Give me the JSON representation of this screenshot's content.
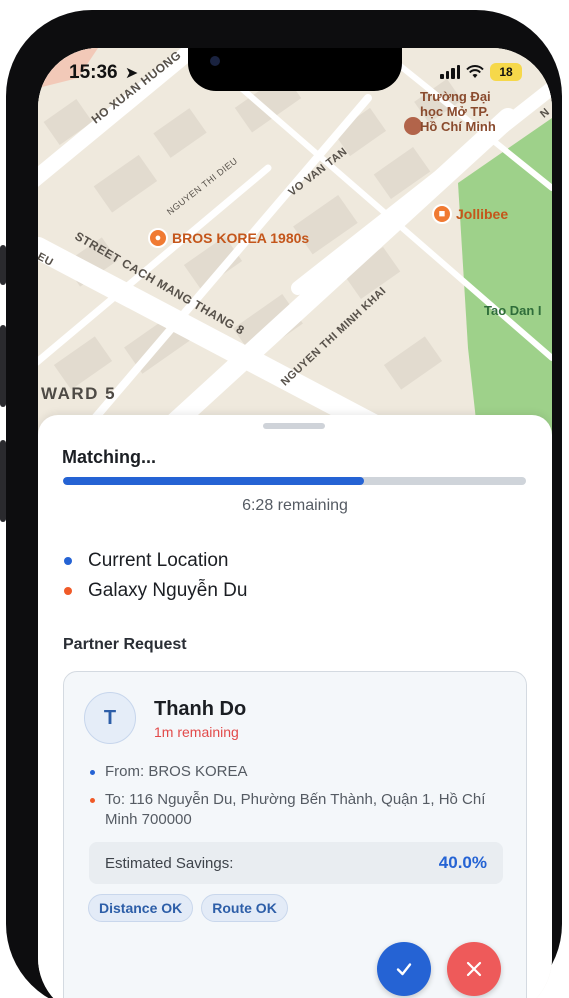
{
  "status_bar": {
    "time": "15:36",
    "battery": "18",
    "icons": [
      "location-arrow-icon",
      "signal-icon",
      "wifi-icon",
      "battery-icon"
    ]
  },
  "map": {
    "district_label": "WARD 5",
    "streets": [
      {
        "name": "HO XUAN HUONG"
      },
      {
        "name": "NGUYEN THI DIEU"
      },
      {
        "name": "VO VAN TAN"
      },
      {
        "name": "STREET CACH MANG THANG 8"
      },
      {
        "name": "NGUYEN THI MINH KHAI"
      },
      {
        "name": "EU"
      },
      {
        "name": "N"
      }
    ],
    "pois": {
      "university": "Trường Đại học Mở TP. Hồ Chí Minh",
      "university_lines": [
        "Trường Đại",
        "học Mở TP.",
        "Hồ Chí Minh"
      ],
      "jollibee": "Jollibee",
      "bros_korea": "BROS KOREA 1980s",
      "park": "Tao Dan I"
    },
    "colors": {
      "park": "#9ed18a",
      "poi": "#f07a32",
      "university_icon": "#b2644a"
    }
  },
  "sheet": {
    "title": "Matching...",
    "progress": 0.65,
    "remaining": "6:28 remaining",
    "current_location": "Current Location",
    "destination": "Galaxy Nguyễn Du",
    "section_title": "Partner Request"
  },
  "partner": {
    "initial": "T",
    "name": "Thanh Do",
    "time_left": "1m remaining",
    "from": "From: BROS KOREA",
    "to": "To: 116 Nguyễn Du, Phường Bến Thành, Quận 1, Hồ Chí Minh 700000",
    "savings_label": "Estimated Savings:",
    "savings_value": "40.0%",
    "chips": [
      "Distance OK",
      "Route OK"
    ],
    "accept_icon": "check-icon",
    "reject_icon": "close-icon"
  },
  "colors": {
    "accent": "#2563d4",
    "origin_dot": "#2563d4",
    "destination_dot": "#f05a28",
    "danger": "#ee5a5a",
    "time_warning": "#e24a4a"
  }
}
